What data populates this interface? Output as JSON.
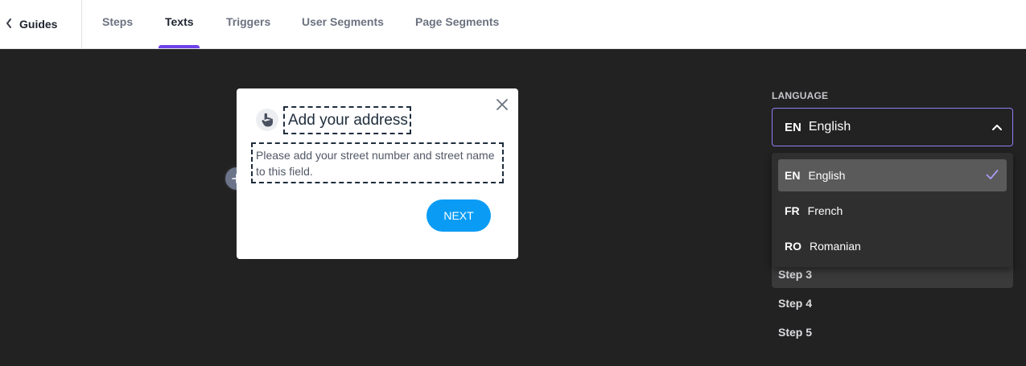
{
  "nav": {
    "back_label": "Guides",
    "back_icon": "chevron-left-icon",
    "tabs": [
      {
        "label": "Steps",
        "active": false
      },
      {
        "label": "Texts",
        "active": true
      },
      {
        "label": "Triggers",
        "active": false
      },
      {
        "label": "User Segments",
        "active": false
      },
      {
        "label": "Page Segments",
        "active": false
      }
    ],
    "accent_color": "#6f42e8"
  },
  "tooltip": {
    "title": "Add your address",
    "body": "Please add your street number and street name to this field.",
    "next_label": "NEXT",
    "next_color": "#0a9cf5",
    "icon": "hand-pointer-icon",
    "add_icon": "plus-icon"
  },
  "language": {
    "label": "LANGUAGE",
    "selected_code": "EN",
    "selected_name": "English",
    "options": [
      {
        "code": "EN",
        "name": "English",
        "selected": true
      },
      {
        "code": "FR",
        "name": "French",
        "selected": false
      },
      {
        "code": "RO",
        "name": "Romanian",
        "selected": false
      }
    ]
  },
  "steps": [
    "Step 3",
    "Step 4",
    "Step 5"
  ],
  "colors": {
    "canvas_bg": "#222222",
    "select_border": "#8e7ff3",
    "dropdown_bg": "#2f2f2f",
    "option_selected_bg": "#5a5a5a"
  }
}
